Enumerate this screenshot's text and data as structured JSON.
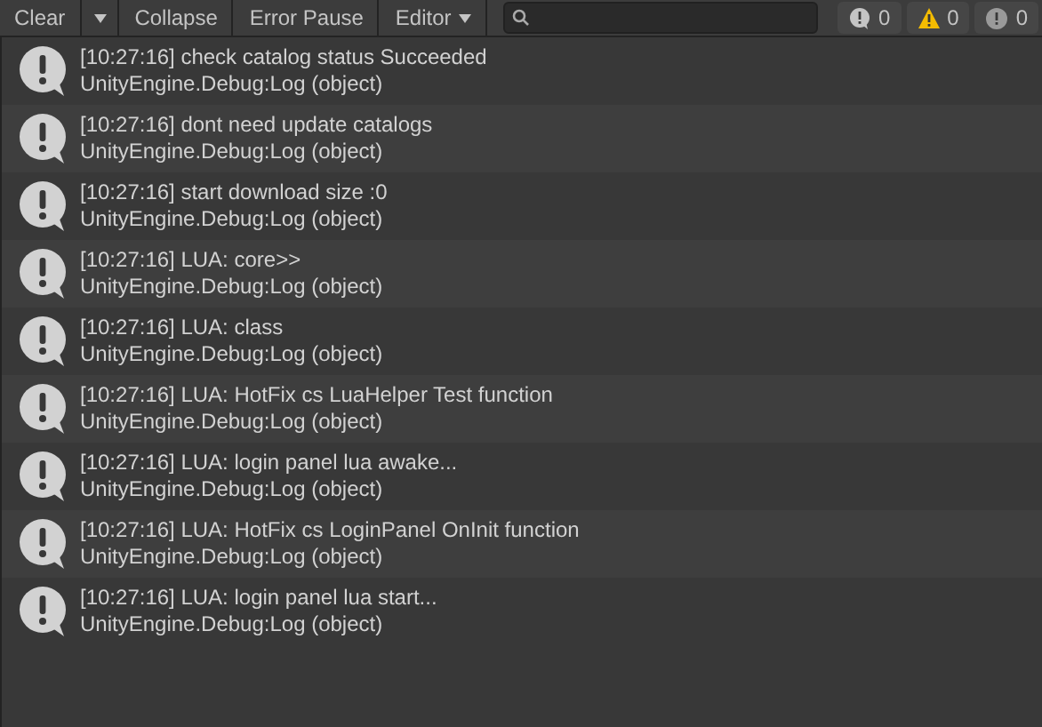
{
  "toolbar": {
    "buttons": [
      {
        "label": "Clear",
        "kind": "button"
      },
      {
        "label": "Collapse",
        "kind": "toggle",
        "on": false
      },
      {
        "label": "Error Pause",
        "kind": "toggle",
        "on": false
      },
      {
        "label": "Editor",
        "kind": "dropdown"
      }
    ],
    "counts": [
      {
        "kind": "info",
        "count": "0"
      },
      {
        "kind": "warning",
        "count": "0"
      },
      {
        "kind": "error",
        "count": "0"
      }
    ]
  },
  "entries": [
    {
      "message": "[10:27:16] check catalog status Succeeded",
      "source": "UnityEngine.Debug:Log (object)"
    },
    {
      "message": "[10:27:16] dont need update catalogs",
      "source": "UnityEngine.Debug:Log (object)"
    },
    {
      "message": "[10:27:16] start download size :0",
      "source": "UnityEngine.Debug:Log (object)"
    },
    {
      "message": "[10:27:16] LUA: core>>",
      "source": "UnityEngine.Debug:Log (object)"
    },
    {
      "message": "[10:27:16] LUA: class",
      "source": "UnityEngine.Debug:Log (object)"
    },
    {
      "message": "[10:27:16] LUA: HotFix cs LuaHelper Test function",
      "source": "UnityEngine.Debug:Log (object)"
    },
    {
      "message": "[10:27:16] LUA: login panel lua awake...",
      "source": "UnityEngine.Debug:Log (object)"
    },
    {
      "message": "[10:27:16] LUA: HotFix cs LoginPanel  OnInit function",
      "source": "UnityEngine.Debug:Log (object)"
    },
    {
      "message": "[10:27:16] LUA: login panel lua start...",
      "source": "UnityEngine.Debug:Log (object)"
    }
  ]
}
